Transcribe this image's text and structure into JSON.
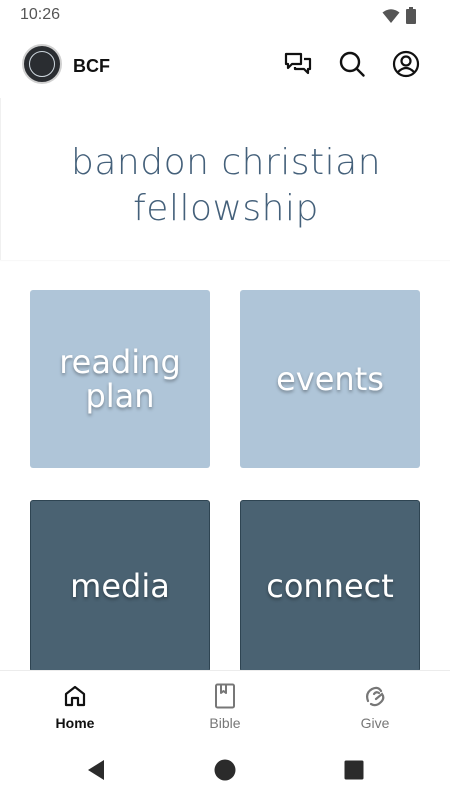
{
  "status_bar": {
    "time": "10:26",
    "icons": [
      "wifi-icon",
      "battery-icon"
    ]
  },
  "app_bar": {
    "title": "BCF",
    "logo": "bcf-logo",
    "actions": [
      "chat-icon",
      "search-icon",
      "account-icon"
    ]
  },
  "header": {
    "line1": "bandon christian",
    "line2": "fellowship"
  },
  "tiles": [
    {
      "line1": "reading",
      "line2": "plan",
      "style": "light"
    },
    {
      "line1": "events",
      "line2": "",
      "style": "light"
    },
    {
      "line1": "media",
      "line2": "",
      "style": "dark"
    },
    {
      "line1": "connect",
      "line2": "",
      "style": "dark"
    }
  ],
  "bottom_nav": [
    {
      "label": "Home",
      "icon": "home-icon",
      "active": true
    },
    {
      "label": "Bible",
      "icon": "bible-icon",
      "active": false
    },
    {
      "label": "Give",
      "icon": "give-icon",
      "active": false
    }
  ],
  "system_nav": [
    "back-icon",
    "home-circle-icon",
    "recents-icon"
  ],
  "colors": {
    "tile_light": "#afc5d8",
    "tile_dark": "#4a6272",
    "header_text": "#44607a"
  }
}
